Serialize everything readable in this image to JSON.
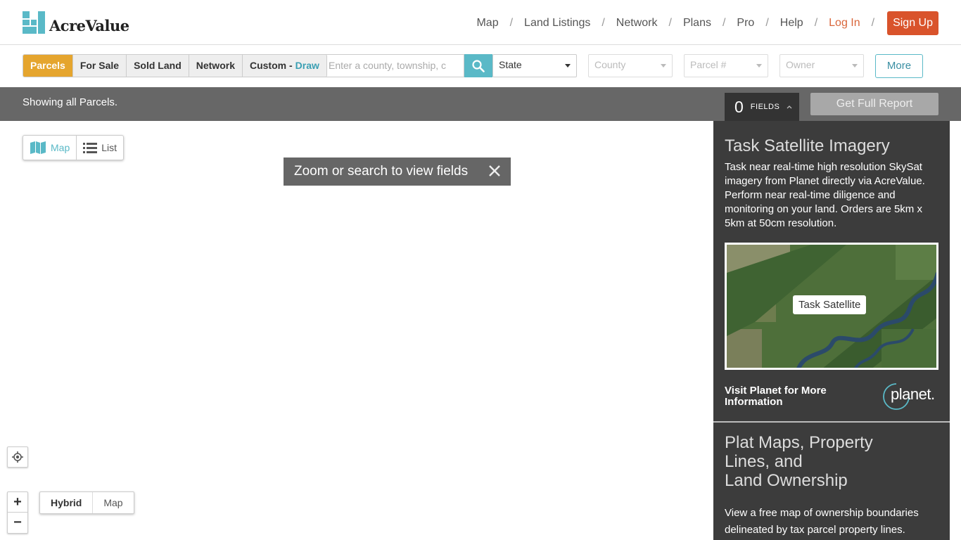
{
  "brand": {
    "name": "AcreValue",
    "accent": "#5ab9c7",
    "orange": "#d9532b"
  },
  "nav": {
    "items": [
      "Map",
      "Land Listings",
      "Network",
      "Plans",
      "Pro",
      "Help"
    ],
    "login": "Log In",
    "signup": "Sign Up",
    "separator": "/"
  },
  "toolbar": {
    "segments": [
      "Parcels",
      "For Sale",
      "Sold Land",
      "Network",
      "Custom -"
    ],
    "draw_label": "Draw",
    "search_placeholder": "Enter a county, township, c",
    "state_label": "State",
    "county_label": "County",
    "parcel_label": "Parcel #",
    "owner_label": "Owner",
    "more_label": "More"
  },
  "status": {
    "text": "Showing all Parcels.",
    "fields_count": "0",
    "fields_label": "FIELDS",
    "report_label": "Get Full Report"
  },
  "map": {
    "view_map": "Map",
    "view_list": "List",
    "toast": "Zoom or search to view fields",
    "zoom_in": "+",
    "zoom_out": "−",
    "type_hybrid": "Hybrid",
    "type_map": "Map"
  },
  "panel": {
    "title": "Task Satellite Imagery",
    "description": "Task near real-time high resolution SkySat imagery from Planet directly via AcreValue. Perform near real-time diligence and monitoring on your land. Orders are 5km x 5km at 50cm resolution.",
    "image_label": "Task Satellite",
    "visit_text": "Visit Planet for More Information",
    "planet_logo_text": "planet.",
    "section2_title_lines": [
      "Plat Maps, Property",
      "Lines, and",
      "Land Ownership"
    ],
    "section2_desc": "View a free map of ownership boundaries delineated by tax parcel property lines."
  }
}
